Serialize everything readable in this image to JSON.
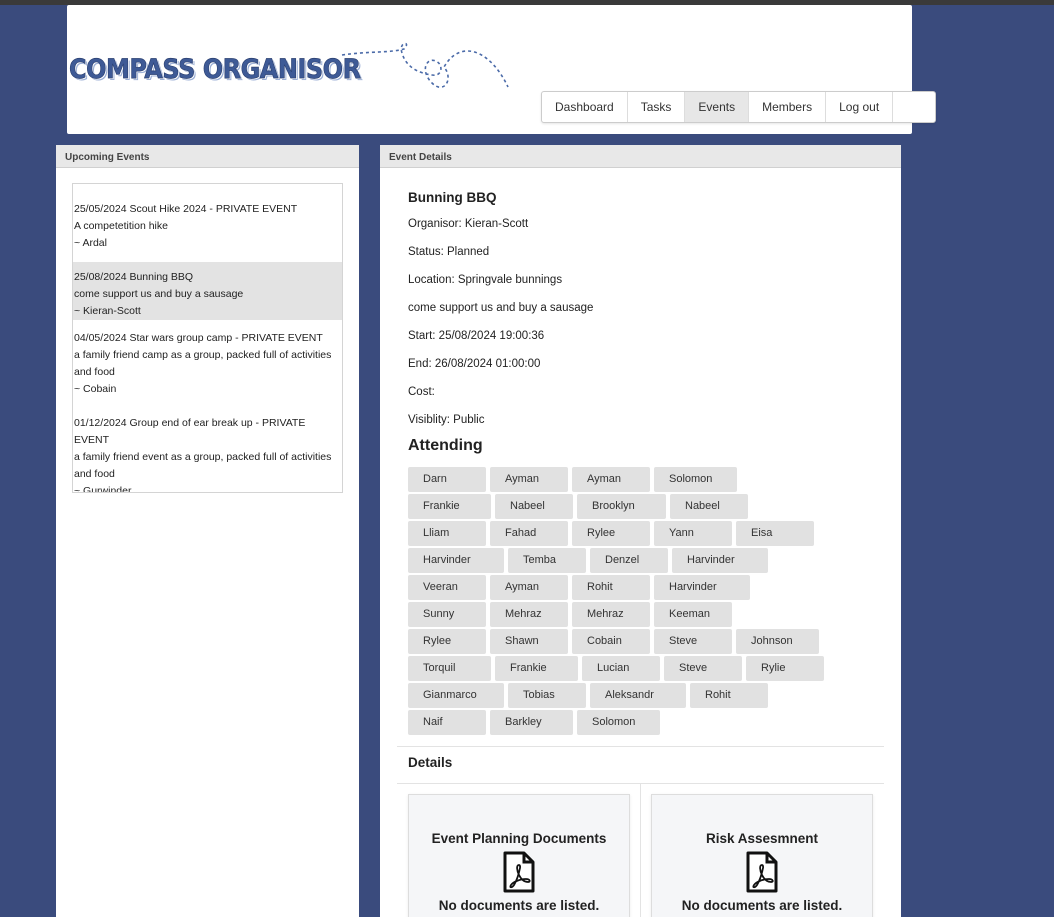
{
  "app": {
    "logo_text": "COMPASS ORGANISOR"
  },
  "nav": {
    "items": [
      {
        "label": "Dashboard",
        "active": false
      },
      {
        "label": "Tasks",
        "active": false
      },
      {
        "label": "Events",
        "active": true
      },
      {
        "label": "Members",
        "active": false
      },
      {
        "label": "Log out",
        "active": false
      }
    ]
  },
  "upcoming": {
    "header": "Upcoming Events",
    "events": [
      {
        "line1": "25/05/2024 Scout Hike 2024 - PRIVATE EVENT",
        "line2": "A competetition hike",
        "line3": "~ Ardal",
        "selected": false
      },
      {
        "line1": "25/08/2024 Bunning BBQ",
        "line2": "come support us and buy a sausage",
        "line3": "~ Kieran-Scott",
        "selected": true
      },
      {
        "line1": "04/05/2024 Star wars group camp - PRIVATE EVENT",
        "line2": "a family friend camp as a group, packed full of activities and food",
        "line3": "~ Cobain",
        "selected": false
      },
      {
        "line1": "01/12/2024 Group end of ear break up - PRIVATE EVENT",
        "line2": "a family friend event as a group, packed full of activities and food",
        "line3": "~ Gurwinder",
        "selected": false
      }
    ]
  },
  "details": {
    "header": "Event Details",
    "title": "Bunning BBQ",
    "organiser": "Organisor: Kieran-Scott",
    "status": "Status: Planned",
    "location": "Location: Springvale bunnings",
    "description": "come support us and buy a sausage",
    "start": "Start: 25/08/2024 19:00:36",
    "end": "End: 26/08/2024 01:00:00",
    "cost": "Cost:",
    "visibility": "Visiblity: Public",
    "attending_title": "Attending",
    "attendees": [
      [
        "Darn",
        "Ayman",
        "Ayman",
        "Solomon"
      ],
      [
        "Frankie",
        "Nabeel",
        "Brooklyn",
        "Nabeel"
      ],
      [
        "Lliam",
        "Fahad",
        "Rylee",
        "Yann",
        "Eisa"
      ],
      [
        "Harvinder",
        "Temba",
        "Denzel",
        "Harvinder"
      ],
      [
        "Veeran",
        "Ayman",
        "Rohit",
        "Harvinder"
      ],
      [
        "Sunny",
        "Mehraz",
        "Mehraz",
        "Keeman"
      ],
      [
        "Rylee",
        "Shawn",
        "Cobain",
        "Steve",
        "Johnson"
      ],
      [
        "Torquil",
        "Frankie",
        "Lucian",
        "Steve",
        "Rylie"
      ],
      [
        "Gianmarco",
        "Tobias",
        "Aleksandr",
        "Rohit"
      ],
      [
        "Naif",
        "Barkley",
        "Solomon"
      ]
    ],
    "details_title": "Details",
    "documents": [
      {
        "title": "Event Planning Documents",
        "empty_text": "No documents are listed.",
        "icon": "pdf-icon"
      },
      {
        "title": "Risk Assesmnent",
        "empty_text": "No documents are listed.",
        "icon": "pdf-icon"
      }
    ]
  }
}
